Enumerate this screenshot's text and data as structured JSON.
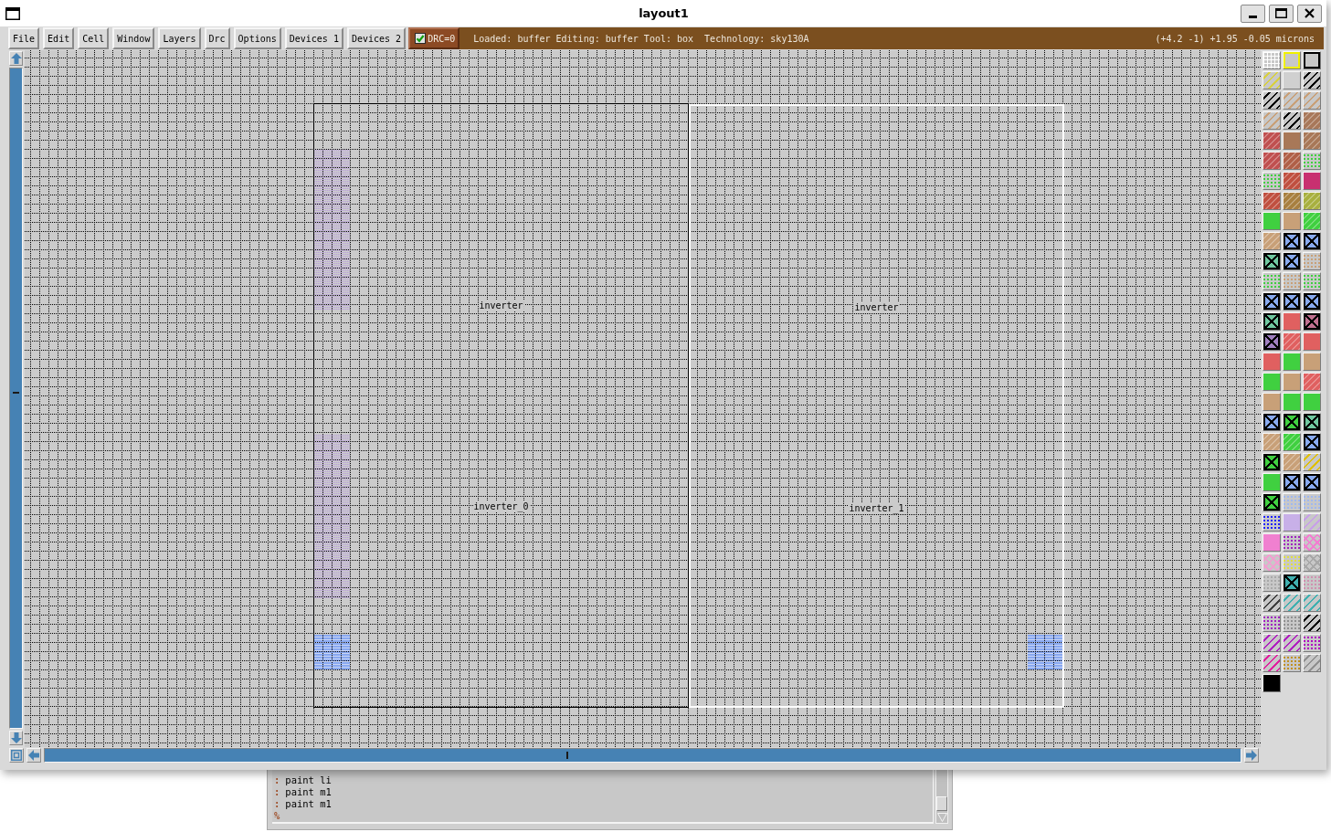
{
  "window": {
    "title": "layout1"
  },
  "menu": [
    "File",
    "Edit",
    "Cell",
    "Window",
    "Layers",
    "Drc",
    "Options",
    "Devices 1",
    "Devices 2"
  ],
  "drc": {
    "label": "DRC=0",
    "checked": true
  },
  "status": {
    "info": "Loaded: buffer Editing: buffer Tool: box  Technology: sky130A",
    "coordinates": "(+4.2 -1) +1.95 -0.05 microns"
  },
  "cells": [
    {
      "cell_name": "inverter",
      "instance": "inverter_0",
      "selected": false
    },
    {
      "cell_name": "inverter",
      "instance": "inverter_1",
      "selected": true
    }
  ],
  "palette": [
    {
      "kind": "grid",
      "color": "#ffffff"
    },
    {
      "kind": "outline",
      "color": "#f0f000"
    },
    {
      "kind": "outline",
      "color": "#000000"
    },
    {
      "kind": "stripes",
      "color": "#d8d040"
    },
    {
      "kind": "solid",
      "color": "#d0d0d0"
    },
    {
      "kind": "stripes",
      "color": "#000000"
    },
    {
      "kind": "stripes",
      "color": "#000000"
    },
    {
      "kind": "stripes",
      "color": "#c8a078"
    },
    {
      "kind": "stripes",
      "color": "#c8a078"
    },
    {
      "kind": "stripes",
      "color": "#c8a078"
    },
    {
      "kind": "stripes",
      "color": "#000000"
    },
    {
      "kind": "hatched",
      "color": "#a8785a"
    },
    {
      "kind": "hatched",
      "color": "#c05050"
    },
    {
      "kind": "solid",
      "color": "#a87858"
    },
    {
      "kind": "hatched",
      "color": "#a87858"
    },
    {
      "kind": "hatched",
      "color": "#c05050"
    },
    {
      "kind": "hatched",
      "color": "#b06048"
    },
    {
      "kind": "dotted",
      "color": "#40d040"
    },
    {
      "kind": "dotted",
      "color": "#40d040"
    },
    {
      "kind": "hatched",
      "color": "#c05040"
    },
    {
      "kind": "solid",
      "color": "#c83070"
    },
    {
      "kind": "hatched",
      "color": "#c05040"
    },
    {
      "kind": "hatched",
      "color": "#a88040"
    },
    {
      "kind": "hatched",
      "color": "#a8b040"
    },
    {
      "kind": "solid",
      "color": "#40d040"
    },
    {
      "kind": "solid",
      "color": "#c8a078"
    },
    {
      "kind": "hatched",
      "color": "#40d040"
    },
    {
      "kind": "hatched",
      "color": "#c8a078"
    },
    {
      "kind": "contact",
      "color": "#88aaf0"
    },
    {
      "kind": "contact",
      "color": "#88aaf0"
    },
    {
      "kind": "contact",
      "color": "#70c8a0"
    },
    {
      "kind": "contact",
      "color": "#88aaf0"
    },
    {
      "kind": "dotted",
      "color": "#c8a078"
    },
    {
      "kind": "dotted",
      "color": "#40d040"
    },
    {
      "kind": "dotted",
      "color": "#c8a078"
    },
    {
      "kind": "dotted",
      "color": "#40d040"
    },
    {
      "kind": "contact",
      "color": "#88aaf0"
    },
    {
      "kind": "contact",
      "color": "#88aaf0"
    },
    {
      "kind": "contact",
      "color": "#88aaf0"
    },
    {
      "kind": "contact",
      "color": "#70c8a0"
    },
    {
      "kind": "solid",
      "color": "#e06060"
    },
    {
      "kind": "contact",
      "color": "#c07090"
    },
    {
      "kind": "contact",
      "color": "#a080c0"
    },
    {
      "kind": "hatched",
      "color": "#e06060"
    },
    {
      "kind": "solid",
      "color": "#e06060"
    },
    {
      "kind": "solid",
      "color": "#e06060"
    },
    {
      "kind": "solid",
      "color": "#40d040"
    },
    {
      "kind": "solid",
      "color": "#c8a078"
    },
    {
      "kind": "solid",
      "color": "#40d040"
    },
    {
      "kind": "solid",
      "color": "#c8a078"
    },
    {
      "kind": "hatched",
      "color": "#e06060"
    },
    {
      "kind": "solid",
      "color": "#c8a078"
    },
    {
      "kind": "solid",
      "color": "#40d040"
    },
    {
      "kind": "solid",
      "color": "#40d040"
    },
    {
      "kind": "contact",
      "color": "#88aaf0"
    },
    {
      "kind": "contact",
      "color": "#40d040"
    },
    {
      "kind": "contact",
      "color": "#70c8a0"
    },
    {
      "kind": "hatched",
      "color": "#c8a078"
    },
    {
      "kind": "hatched",
      "color": "#40d040"
    },
    {
      "kind": "contact",
      "color": "#88aaf0"
    },
    {
      "kind": "contact",
      "color": "#40d040"
    },
    {
      "kind": "hatched",
      "color": "#c8a078"
    },
    {
      "kind": "stripes",
      "color": "#e0c000"
    },
    {
      "kind": "solid",
      "color": "#40d040"
    },
    {
      "kind": "contact",
      "color": "#88aaf0"
    },
    {
      "kind": "contact",
      "color": "#88aaf0"
    },
    {
      "kind": "contact",
      "color": "#40d040"
    },
    {
      "kind": "dotted",
      "color": "#a0b8f0"
    },
    {
      "kind": "dotted",
      "color": "#a0b8f0"
    },
    {
      "kind": "dotted",
      "color": "#2020ff"
    },
    {
      "kind": "solid",
      "color": "#c8b0e8"
    },
    {
      "kind": "stripes",
      "color": "#c8a0e8"
    },
    {
      "kind": "solid",
      "color": "#f080d0"
    },
    {
      "kind": "dotted",
      "color": "#a020c0"
    },
    {
      "kind": "crosshatch",
      "color": "#f080d0"
    },
    {
      "kind": "crosshatch",
      "color": "#f0a0d0"
    },
    {
      "kind": "dotted",
      "color": "#e0e040"
    },
    {
      "kind": "crosshatch",
      "color": "#a8a8a8"
    },
    {
      "kind": "dotted",
      "color": "#a8a8a8"
    },
    {
      "kind": "contact",
      "color": "#40b0b0"
    },
    {
      "kind": "dotted",
      "color": "#d090b0"
    },
    {
      "kind": "stripes",
      "color": "#404040"
    },
    {
      "kind": "stripes",
      "color": "#40b0b0"
    },
    {
      "kind": "stripes",
      "color": "#40b0b0"
    },
    {
      "kind": "dotted",
      "color": "#a020c0"
    },
    {
      "kind": "dotted",
      "color": "#909090"
    },
    {
      "kind": "stripes",
      "color": "#000000"
    },
    {
      "kind": "stripes",
      "color": "#b020c0"
    },
    {
      "kind": "stripes",
      "color": "#b020c0"
    },
    {
      "kind": "dotted",
      "color": "#b000c0"
    },
    {
      "kind": "stripes",
      "color": "#e020a0"
    },
    {
      "kind": "dotted",
      "color": "#c09020"
    },
    {
      "kind": "stripes",
      "color": "#909090"
    },
    {
      "kind": "solid",
      "color": "#000000"
    }
  ],
  "console": {
    "lines": [
      {
        "prompt": ":",
        "command": "paint li"
      },
      {
        "prompt": ":",
        "command": "paint m1"
      },
      {
        "prompt": ":",
        "command": "paint m1"
      }
    ],
    "prompt": "%"
  }
}
